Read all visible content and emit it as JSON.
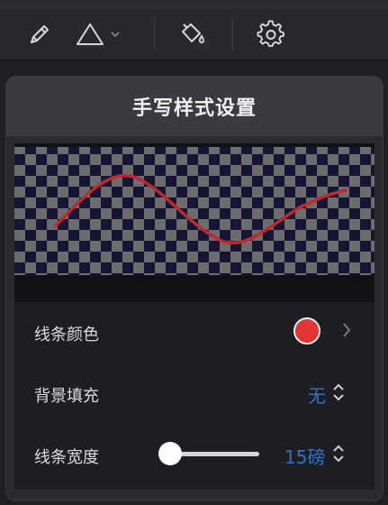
{
  "toolbar": {
    "icons": [
      "pencil-icon",
      "triangle-icon",
      "chevron-down-icon",
      "paint-bucket-icon",
      "gear-icon"
    ]
  },
  "panel": {
    "title": "手写样式设置",
    "preview": {
      "line_color": "#c0282f",
      "checker_dark": "#151633",
      "checker_light": "#6d6d70"
    },
    "rows": {
      "line_color": {
        "label": "线条颜色",
        "swatch_color": "#e53434"
      },
      "background_fill": {
        "label": "背景填充",
        "value": "无"
      },
      "line_width": {
        "label": "线条宽度",
        "value": "15磅",
        "slider_level": 0.0
      }
    }
  },
  "colors": {
    "accent": "#2f73c8",
    "panel_bg": "#2a2b2e",
    "header_bg": "#3a3b3e"
  }
}
